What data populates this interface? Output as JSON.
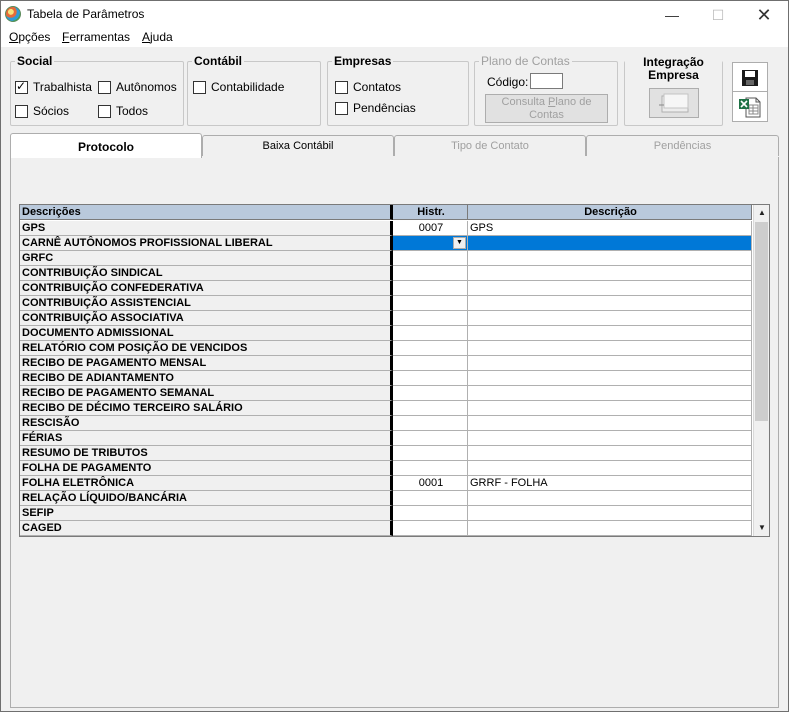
{
  "window": {
    "title": "Tabela de Parâmetros",
    "min_glyph": "—",
    "max_glyph": "☐",
    "close_glyph": "✕"
  },
  "menu": [
    {
      "pre": "",
      "accel": "O",
      "post": "pções"
    },
    {
      "pre": "",
      "accel": "F",
      "post": "erramentas"
    },
    {
      "pre": "",
      "accel": "A",
      "post": "juda"
    }
  ],
  "social": {
    "title": "Social",
    "trabalhista": "Trabalhista",
    "autonomos": "Autônomos",
    "socios": "Sócios",
    "todos": "Todos",
    "trabalhista_checked": true
  },
  "contabil": {
    "title": "Contábil",
    "contabilidade": "Contabilidade"
  },
  "empresas": {
    "title": "Empresas",
    "contatos": "Contatos",
    "pendencias": "Pendências"
  },
  "plano": {
    "title": "Plano de Contas",
    "codigo_label": "Código:",
    "consulta_pre": "Consulta ",
    "consulta_accel": "P",
    "consulta_post": "lano de",
    "consulta_line2": "Contas"
  },
  "integracao": {
    "line1": "Integração",
    "line2": "Empresa"
  },
  "tabs": [
    {
      "label": "Protocolo",
      "active": true
    },
    {
      "label": "Baixa Contábil"
    },
    {
      "label": "Tipo de Contato",
      "disabled": true
    },
    {
      "label": "Pendências",
      "disabled": true
    }
  ],
  "grid": {
    "headers": {
      "descricoes": "Descrições",
      "histr": "Histr.",
      "descricao": "Descrição"
    },
    "rows": [
      {
        "desc": "GPS",
        "histr": "0007",
        "descricao": "GPS"
      },
      {
        "desc": "CARNÊ AUTÔNOMOS PROFISSIONAL LIBERAL",
        "histr": "",
        "descricao": "",
        "selected": true
      },
      {
        "desc": "GRFC",
        "histr": "",
        "descricao": ""
      },
      {
        "desc": "CONTRIBUIÇÃO SINDICAL",
        "histr": "",
        "descricao": ""
      },
      {
        "desc": "CONTRIBUIÇÃO CONFEDERATIVA",
        "histr": "",
        "descricao": ""
      },
      {
        "desc": "CONTRIBUIÇÃO ASSISTENCIAL",
        "histr": "",
        "descricao": ""
      },
      {
        "desc": "CONTRIBUIÇÃO ASSOCIATIVA",
        "histr": "",
        "descricao": ""
      },
      {
        "desc": "DOCUMENTO ADMISSIONAL",
        "histr": "",
        "descricao": ""
      },
      {
        "desc": "RELATÓRIO COM POSIÇÃO DE VENCIDOS",
        "histr": "",
        "descricao": ""
      },
      {
        "desc": "RECIBO DE PAGAMENTO MENSAL",
        "histr": "",
        "descricao": ""
      },
      {
        "desc": "RECIBO DE ADIANTAMENTO",
        "histr": "",
        "descricao": ""
      },
      {
        "desc": "RECIBO DE PAGAMENTO SEMANAL",
        "histr": "",
        "descricao": ""
      },
      {
        "desc": "RECIBO DE DÉCIMO TERCEIRO SALÁRIO",
        "histr": "",
        "descricao": ""
      },
      {
        "desc": "RESCISÃO",
        "histr": "",
        "descricao": ""
      },
      {
        "desc": "FÉRIAS",
        "histr": "",
        "descricao": ""
      },
      {
        "desc": "RESUMO DE TRIBUTOS",
        "histr": "",
        "descricao": ""
      },
      {
        "desc": "FOLHA DE PAGAMENTO",
        "histr": "",
        "descricao": ""
      },
      {
        "desc": "FOLHA ELETRÔNICA",
        "histr": "0001",
        "descricao": "GRRF - FOLHA"
      },
      {
        "desc": "RELAÇÃO LÍQUIDO/BANCÁRIA",
        "histr": "",
        "descricao": ""
      },
      {
        "desc": "SEFIP",
        "histr": "",
        "descricao": ""
      },
      {
        "desc": "CAGED",
        "histr": "",
        "descricao": ""
      }
    ]
  },
  "colors": {
    "header_bg": "#b9c9dc",
    "selection": "#0078d7"
  }
}
